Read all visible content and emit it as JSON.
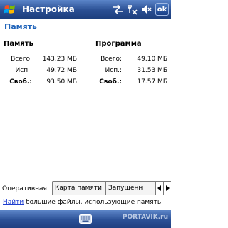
{
  "titlebar": {
    "title": "Настройка",
    "ok_label": "ok"
  },
  "heading": "Память",
  "memory": {
    "title": "Память",
    "rows": [
      {
        "label": "Всего:",
        "value": "143.23 МБ"
      },
      {
        "label": "Исп.:",
        "value": "49.72 МБ"
      },
      {
        "label": "Своб.:",
        "value": "93.50 МБ"
      }
    ]
  },
  "program": {
    "title": "Программа",
    "rows": [
      {
        "label": "Всего:",
        "value": "49.10 МБ"
      },
      {
        "label": "Исп.:",
        "value": "31.53 МБ"
      },
      {
        "label": "Своб.:",
        "value": "17.57 МБ"
      }
    ]
  },
  "tabs": [
    {
      "label": "Оперативная"
    },
    {
      "label": "Карта памяти"
    },
    {
      "label": "Запущенн"
    }
  ],
  "find": {
    "link": "Найти",
    "text": " большие файлы, использующие память."
  },
  "watermark": "PORTAVIK.ru",
  "icons": [
    "windows-start-icon",
    "connectivity-icon",
    "signal-off-icon",
    "volume-mute-icon",
    "keyboard-icon",
    "scroll-left-icon",
    "scroll-right-icon"
  ],
  "colors": {
    "titlebar": "#2a4f93",
    "heading": "#1f63b9",
    "link": "#1f3fcf"
  }
}
